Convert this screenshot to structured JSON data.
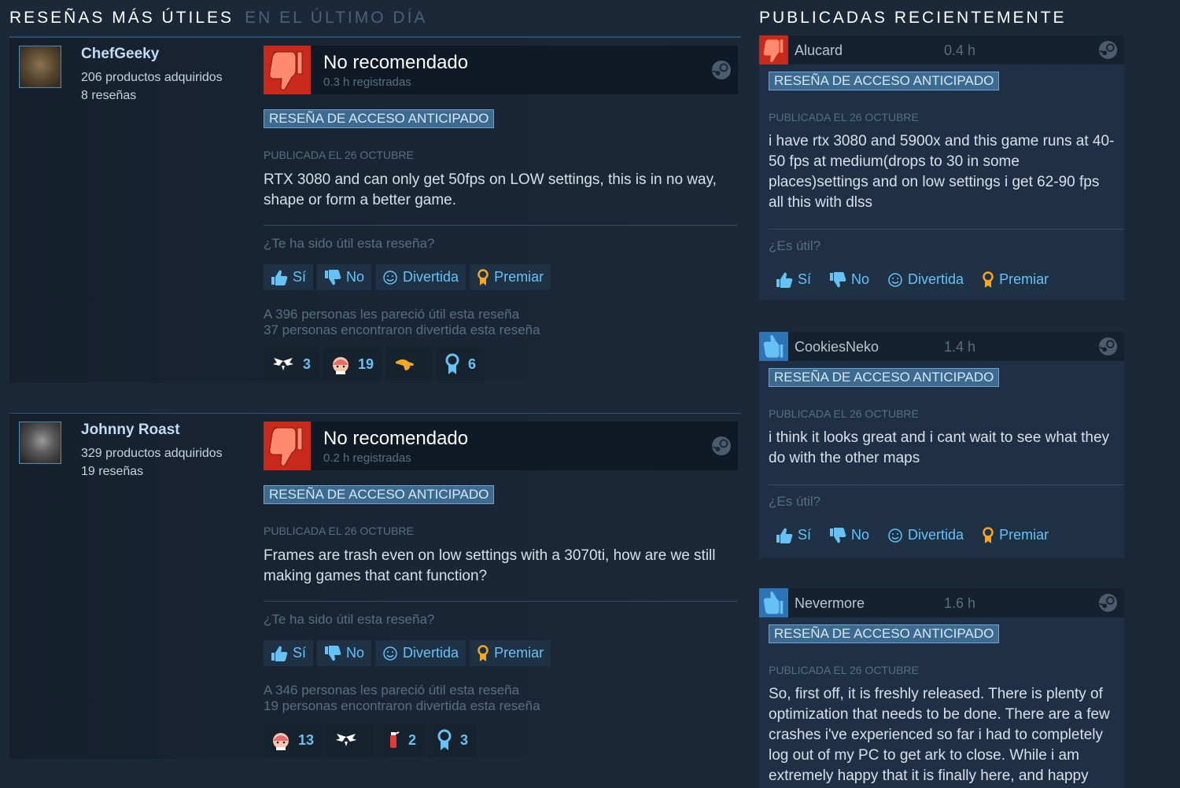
{
  "left": {
    "title": "RESEÑAS MÁS ÚTILES",
    "subtitle": "EN EL ÚLTIMO DÍA",
    "reviews": [
      {
        "author": "ChefGeeky",
        "products": "206 productos adquiridos",
        "reviews_count": "8 reseñas",
        "verdict": "No recomendado",
        "hours": "0.3 h registradas",
        "badge": "RESEÑA DE ACCESO ANTICIPADO",
        "posted": "PUBLICADA EL 26 OCTUBRE",
        "text": "RTX 3080 and can only get 50fps on LOW settings, this is in no way, shape or form a better game.",
        "helpful_question": "¿Te ha sido útil esta reseña?",
        "helpful_stat": "A 396 personas les pareció útil esta reseña",
        "funny_stat": "37 personas encontraron divertida esta reseña",
        "awards": [
          "3",
          "19",
          "",
          "6"
        ]
      },
      {
        "author": "Johnny Roast",
        "products": "329 productos adquiridos",
        "reviews_count": "19 reseñas",
        "verdict": "No recomendado",
        "hours": "0.2 h registradas",
        "badge": "RESEÑA DE ACCESO ANTICIPADO",
        "posted": "PUBLICADA EL 26 OCTUBRE",
        "text": "Frames are trash even on low settings with a 3070ti, how are we still making games that cant function?",
        "helpful_question": "¿Te ha sido útil esta reseña?",
        "helpful_stat": "A 346 personas les pareció útil esta reseña",
        "funny_stat": "19 personas encontraron divertida esta reseña",
        "awards": [
          "13",
          "",
          "2",
          "3"
        ]
      }
    ]
  },
  "vote": {
    "yes": "Sí",
    "no": "No",
    "funny": "Divertida",
    "award": "Premiar"
  },
  "right": {
    "title": "PUBLICADAS RECIENTEMENTE",
    "helpful_question": "¿Es útil?",
    "reviews": [
      {
        "author": "Alucard",
        "hours": "0.4 h",
        "badge": "RESEÑA DE ACCESO ANTICIPADO",
        "posted": "PUBLICADA EL 26 OCTUBRE",
        "text": "i have rtx 3080 and 5900x and this game runs at 40-50 fps at medium(drops to 30 in some places)settings and on low settings i get 62-90 fps all this with dlss"
      },
      {
        "author": "CookiesNeko",
        "hours": "1.4 h",
        "badge": "RESEÑA DE ACCESO ANTICIPADO",
        "posted": "PUBLICADA EL 26 OCTUBRE",
        "text": "i think it looks great and i cant wait to see what they do with the other maps"
      },
      {
        "author": "Nevermore",
        "hours": "1.6 h",
        "badge": "RESEÑA DE ACCESO ANTICIPADO",
        "posted": "PUBLICADA EL 26 OCTUBRE",
        "text": "So, first off, it is freshly released. There is plenty of optimization that needs to be done. There are a few crashes i've experienced so far i had to completely log out of my PC to get ark to close. While i am extremely happy that it is finally here, and happy that we can play it, we"
      }
    ]
  },
  "colors": {
    "background": "#1b2838",
    "thumb_down": "#c8291b",
    "thumb_up": "#2d73b8",
    "link": "#67c1f5",
    "badge_bg": "#3d6a8f",
    "award_gold": "#f5a623"
  }
}
